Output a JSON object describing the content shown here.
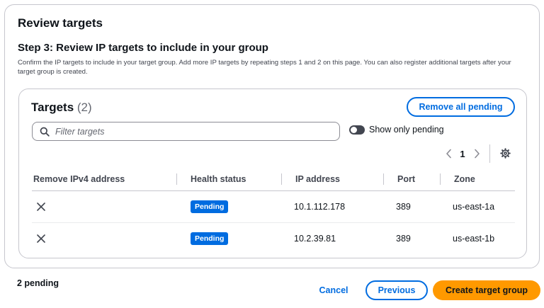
{
  "card": {
    "title": "Review targets",
    "step_title": "Step 3: Review IP targets to include in your group",
    "step_description": "Confirm the IP targets to include in your target group. Add more IP targets by repeating steps 1 and 2 on this page. You can also register additional targets after your target group is created."
  },
  "targets": {
    "title": "Targets",
    "count": "(2)",
    "remove_all_label": "Remove all pending",
    "search_placeholder": "Filter targets",
    "toggle_label": "Show only pending",
    "toggle_on": false,
    "current_page": "1",
    "columns": [
      "Remove IPv4 address",
      "Health status",
      "IP address",
      "Port",
      "Zone"
    ],
    "rows": [
      {
        "health": "Pending",
        "ip": "10.1.112.178",
        "port": "389",
        "zone": "us-east-1a"
      },
      {
        "health": "Pending",
        "ip": "10.2.39.81",
        "port": "389",
        "zone": "us-east-1b"
      }
    ]
  },
  "footer": {
    "pending_text": "2 pending",
    "cancel_label": "Cancel",
    "previous_label": "Previous",
    "create_label": "Create target group"
  },
  "icons": {
    "search": "search-icon",
    "remove": "close-icon",
    "prev_page": "chevron-left-icon",
    "next_page": "chevron-right-icon",
    "settings": "gear-icon"
  },
  "colors": {
    "accent": "#006ce0",
    "primary_button": "#ff9900",
    "badge": "#006ce0",
    "border": "#c6c6cd"
  }
}
